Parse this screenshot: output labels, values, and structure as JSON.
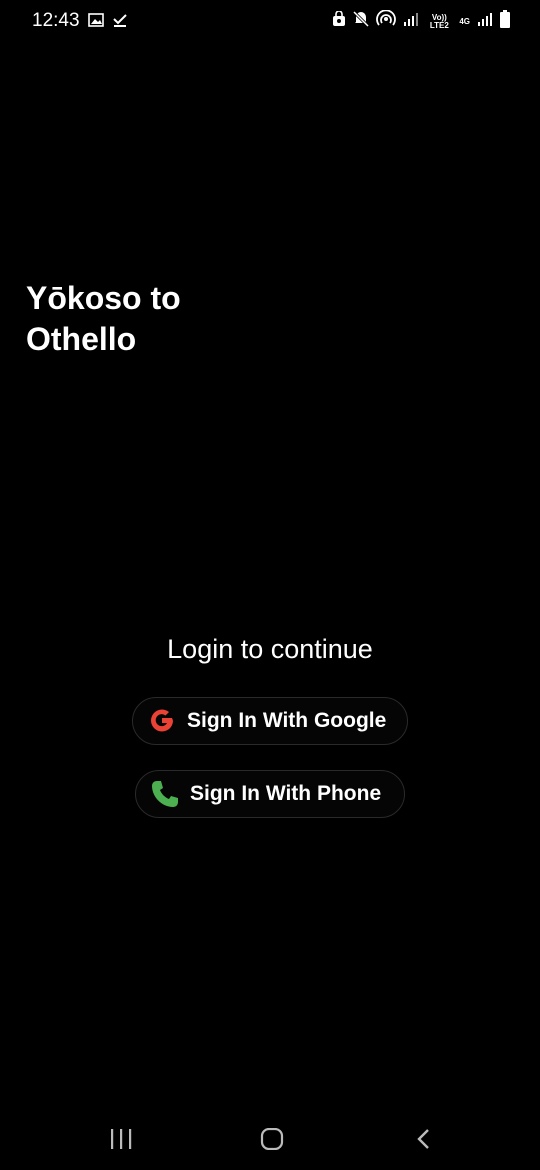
{
  "status_bar": {
    "time": "12:43",
    "volte_label": "Vo)) LTE2",
    "network_label": "4G",
    "icons": [
      "gallery-icon",
      "download-done-icon",
      "lock-badge-icon",
      "mute-icon",
      "hotspot-icon",
      "signal-icon",
      "signal-icon",
      "battery-icon"
    ]
  },
  "welcome": {
    "title": "Yōkoso to Othello"
  },
  "login": {
    "prompt": "Login to continue",
    "google_label": "Sign In With Google",
    "phone_label": "Sign In With Phone"
  },
  "colors": {
    "background": "#000000",
    "google_red": "#EA4335",
    "phone_green": "#4CAF50"
  },
  "nav_bar": {
    "icons": [
      "recent-apps-icon",
      "home-icon",
      "back-icon"
    ]
  }
}
